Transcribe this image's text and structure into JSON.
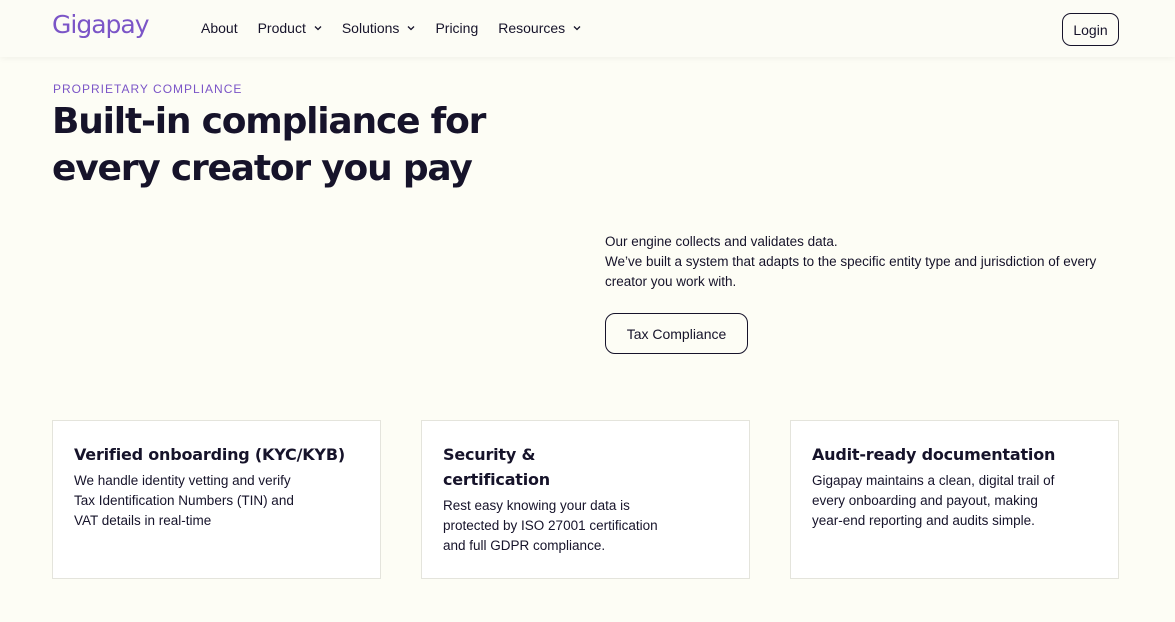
{
  "brand": {
    "logo_text": "Gigapay",
    "accent_color": "#7b55c7"
  },
  "nav": {
    "items": [
      {
        "label": "About",
        "dropdown": false
      },
      {
        "label": "Product",
        "dropdown": true
      },
      {
        "label": "Solutions",
        "dropdown": true
      },
      {
        "label": "Pricing",
        "dropdown": false
      },
      {
        "label": "Resources",
        "dropdown": true
      }
    ],
    "login_label": "Login"
  },
  "hero": {
    "eyebrow": "PROPRIETARY COMPLIANCE",
    "headline_line1": "Built-in compliance for",
    "headline_line2": "every creator you pay",
    "intro_line1": "Our engine collects and validates data.",
    "intro_line2": "We’ve built a system that adapts to the specific entity type and jurisdiction of every creator you work with.",
    "cta_label": "Tax Compliance"
  },
  "features": [
    {
      "title": "Verified onboarding (KYC/KYB)",
      "body": "We handle identity vetting and verify Tax Identification Numbers (TIN) and VAT details in real-time"
    },
    {
      "title": "Security & certification",
      "body": "Rest easy knowing your data is protected by ISO 27001 certification and full GDPR compliance."
    },
    {
      "title": "Audit-ready documentation",
      "body": "Gigapay maintains a clean, digital trail of every onboarding and payout, making year-end reporting and audits simple."
    }
  ]
}
